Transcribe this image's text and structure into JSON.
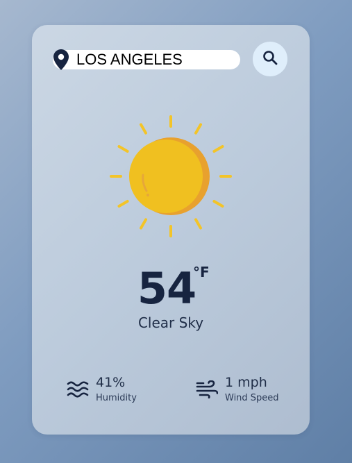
{
  "search": {
    "value": "LOS ANGELES",
    "pin_icon": "location-pin-icon",
    "button_icon": "search-icon"
  },
  "weather": {
    "icon": "sun-icon",
    "temperature": "54",
    "unit": "°F",
    "condition": "Clear Sky"
  },
  "stats": {
    "humidity": {
      "icon": "waves-icon",
      "value": "41%",
      "label": "Humidity"
    },
    "wind": {
      "icon": "wind-icon",
      "value": "1 mph",
      "label": "Wind Speed"
    }
  },
  "colors": {
    "sun": "#f0c020",
    "sun_shade": "#e8a030",
    "text_dark": "#172440",
    "search_button_bg": "#dfeefb"
  }
}
